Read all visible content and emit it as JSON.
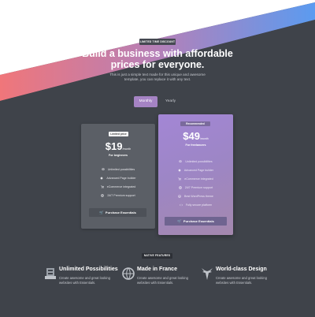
{
  "hero": {
    "badge": "LIMITED TIME DISCOUNT",
    "headline_line1": "Build a business with affordable",
    "headline_line2": "prices for everyone.",
    "subtext_line1": "This is just a simple text made for this unique and awesome",
    "subtext_line2": "template, you can replace it with any text."
  },
  "billing_toggle": {
    "monthly": "Monthly",
    "yearly": "Yearly",
    "selected": "Monthly"
  },
  "plans": [
    {
      "label": "Limited price",
      "price": "$19",
      "period": "/month",
      "audience": "For beginners",
      "features": [
        {
          "icon": "stack-icon",
          "text": "Unlimited possibilities"
        },
        {
          "icon": "diamond-icon",
          "text": "Advanced Page builder"
        },
        {
          "icon": "cart-icon",
          "text": "eCommerce integrated"
        },
        {
          "icon": "globe-icon",
          "text": "24/7 Premium support"
        }
      ],
      "cta": "Purchase Essentials"
    },
    {
      "label": "Recommended",
      "price": "$49",
      "period": "/month",
      "audience": "For freelancers",
      "features": [
        {
          "icon": "stack-icon",
          "text": "Unlimited possibilities"
        },
        {
          "icon": "diamond-icon",
          "text": "Advanced Page builder"
        },
        {
          "icon": "cart-icon",
          "text": "eCommerce integrated"
        },
        {
          "icon": "globe-icon",
          "text": "24/7 Premium support"
        },
        {
          "icon": "wordpress-icon",
          "text": "Best WordPress theme"
        },
        {
          "icon": "code-icon",
          "text": "Fully secure platform"
        }
      ],
      "cta": "Purchase Essentials"
    }
  ],
  "native": {
    "badge": "NATIVE FEATURES",
    "items": [
      {
        "icon": "layers-icon",
        "title": "Unlimited Possibilities",
        "desc": "Create awesome and great looking websites with Essentials."
      },
      {
        "icon": "globe-icon",
        "title": "Made in France",
        "desc": "Create awesome and great looking websites with Essentials."
      },
      {
        "icon": "deer-icon",
        "title": "World-class Design",
        "desc": "Create awesome and great looking websites with Essentials."
      }
    ]
  },
  "colors": {
    "background": "#3f434a",
    "gradient_start": "#f0767a",
    "gradient_end": "#5b9bf0",
    "accent": "#a583c4"
  }
}
